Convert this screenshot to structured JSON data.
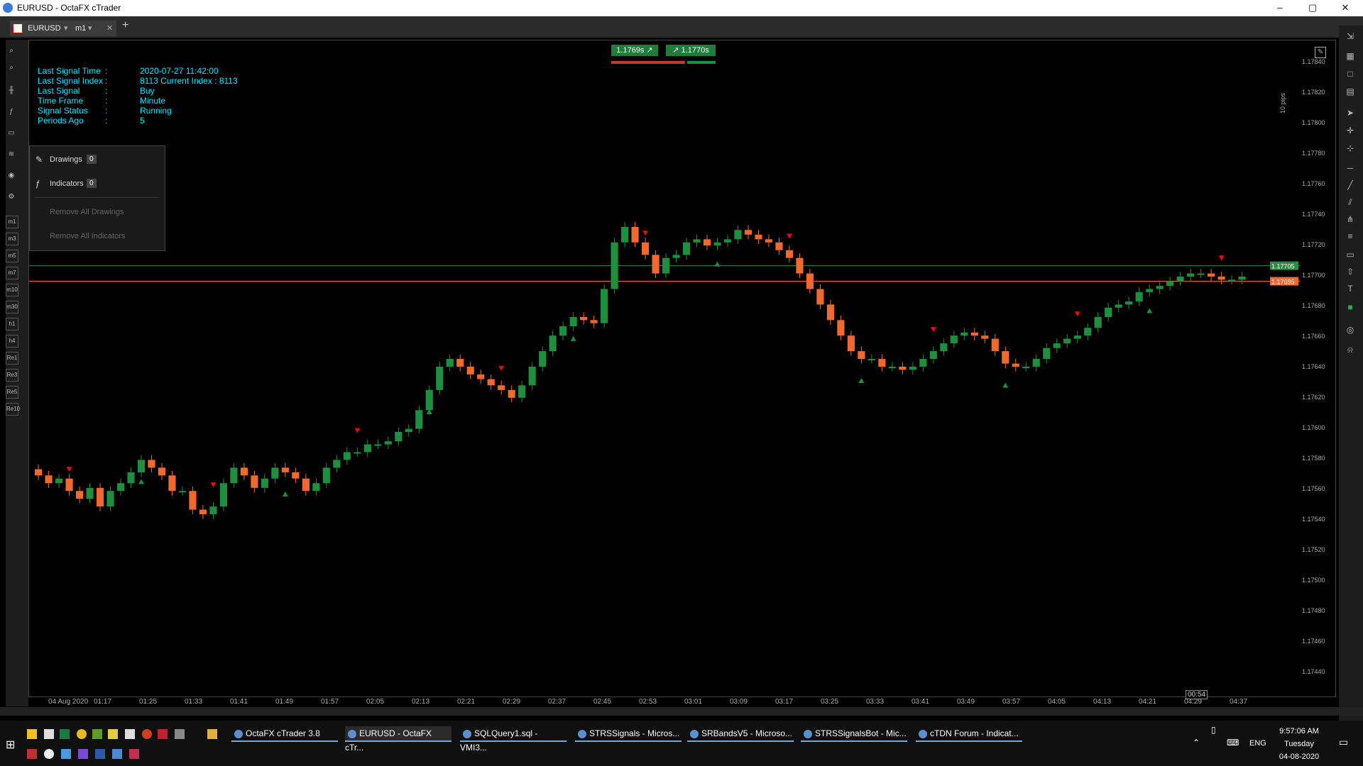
{
  "window": {
    "title": "EURUSD - OctaFX cTrader",
    "controls": [
      "–",
      "▢",
      "✕"
    ]
  },
  "tabs": [
    {
      "label": "EURUSD",
      "timeframe": "m1"
    }
  ],
  "toolbar_left": [
    "m1",
    "m3",
    "m5",
    "m7",
    "m10",
    "m30",
    "h1",
    "h4",
    "Re1",
    "Re3",
    "Re5",
    "Re10"
  ],
  "signal_info": [
    {
      "label": "Last Signal Time",
      "sep": ":",
      "value": "2020-07-27 11:42:00"
    },
    {
      "label": "Last Signal Index",
      "sep": ":",
      "value": "8113 Current Index : 8113"
    },
    {
      "label": "Last Signal",
      "sep": ":",
      "value": "Buy"
    },
    {
      "label": "Time Frame",
      "sep": ":",
      "value": "Minute"
    },
    {
      "label": "Signal Status",
      "sep": ":",
      "value": "Running"
    },
    {
      "label": "Periods Ago",
      "sep": ":",
      "value": "5"
    }
  ],
  "panel": {
    "drawings_label": "Drawings",
    "drawings_count": "0",
    "indicators_label": "Indicators",
    "indicators_count": "0",
    "remove_drawings": "Remove All Drawings",
    "remove_indicators": "Remove All Indicators"
  },
  "price_boxes": {
    "bid": "1.1769s",
    "ask": "1.1770s"
  },
  "pips_label": "10 pips",
  "line_labels": {
    "green": "1.17705",
    "red": "1.17695"
  },
  "colors": {
    "up": "#1e8f3e",
    "down": "#f06a30",
    "bid_line": "#ff5a2a",
    "ask_line": "#2e8b46",
    "signal_up": "#1e8f3e",
    "signal_down": "#e01010",
    "info_text": "#00e5ff"
  },
  "y_axis": [
    "1.17840",
    "1.17820",
    "1.17800",
    "1.17780",
    "1.17760",
    "1.17740",
    "1.17720",
    "1.17700",
    "1.17680",
    "1.17660",
    "1.17640",
    "1.17620",
    "1.17600",
    "1.17580",
    "1.17560",
    "1.17540",
    "1.17520",
    "1.17500",
    "1.17480",
    "1.17460",
    "1.17440"
  ],
  "x_axis": [
    "04 Aug 2020",
    "01:17",
    "01:25",
    "01:33",
    "01:41",
    "01:49",
    "01:57",
    "02:05",
    "02:13",
    "02:21",
    "02:29",
    "02:37",
    "02:45",
    "02:53",
    "03:01",
    "03:09",
    "03:17",
    "03:25",
    "03:33",
    "03:41",
    "03:49",
    "03:57",
    "04:05",
    "04:13",
    "04:21",
    "04:29",
    "04:37"
  ],
  "countdown": "00:54",
  "taskbar": {
    "items": [
      "OctaFX cTrader 3.8",
      "EURUSD - OctaFX cTr...",
      "SQLQuery1.sql - VMI3...",
      "STRSSignals - Micros...",
      "SRBandsV5 - Microso...",
      "STRSSignalsBot - Mic...",
      "cTDN Forum - Indicat..."
    ],
    "lang": "ENG",
    "time": "9:57:06 AM",
    "day": "Tuesday",
    "date": "04-08-2020"
  },
  "chart_data": {
    "type": "candlestick",
    "ylim": [
      1.1743,
      1.1785
    ],
    "close_series": [
      1.1757,
      1.17565,
      1.17568,
      1.1756,
      1.17555,
      1.17562,
      1.1755,
      1.1756,
      1.17565,
      1.17572,
      1.1758,
      1.17575,
      1.1757,
      1.1756,
      1.1756,
      1.17548,
      1.17545,
      1.1755,
      1.17565,
      1.17575,
      1.1757,
      1.17562,
      1.17568,
      1.17575,
      1.17572,
      1.17568,
      1.1756,
      1.17565,
      1.17575,
      1.1758,
      1.17585,
      1.17585,
      1.1759,
      1.1759,
      1.17592,
      1.17598,
      1.176,
      1.17612,
      1.17625,
      1.1764,
      1.17645,
      1.1764,
      1.17635,
      1.17632,
      1.17628,
      1.17625,
      1.1762,
      1.17628,
      1.1764,
      1.1765,
      1.1766,
      1.17666,
      1.17672,
      1.1767,
      1.17668,
      1.1769,
      1.1772,
      1.1773,
      1.1772,
      1.17712,
      1.177,
      1.1771,
      1.17712,
      1.1772,
      1.17722,
      1.17718,
      1.1772,
      1.17722,
      1.17728,
      1.17725,
      1.17722,
      1.1772,
      1.17715,
      1.1771,
      1.177,
      1.1769,
      1.1768,
      1.1767,
      1.1766,
      1.1765,
      1.17645,
      1.17645,
      1.1764,
      1.1764,
      1.17638,
      1.1764,
      1.17645,
      1.1765,
      1.17655,
      1.1766,
      1.17662,
      1.1766,
      1.17658,
      1.1765,
      1.17642,
      1.1764,
      1.1764,
      1.17645,
      1.17652,
      1.17655,
      1.17658,
      1.1766,
      1.17665,
      1.17672,
      1.17678,
      1.1768,
      1.17682,
      1.17688,
      1.1769,
      1.17692,
      1.17695,
      1.17698,
      1.177,
      1.177,
      1.17698,
      1.17696,
      1.17696,
      1.17698
    ]
  }
}
